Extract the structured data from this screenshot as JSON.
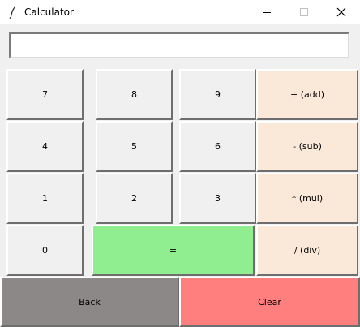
{
  "window": {
    "title": "Calculator",
    "icon": "feather-icon"
  },
  "display": {
    "value": ""
  },
  "keys": {
    "seven": "7",
    "eight": "8",
    "nine": "9",
    "four": "4",
    "five": "5",
    "six": "6",
    "one": "1",
    "two": "2",
    "three": "3",
    "zero": "0",
    "add": "+ (add)",
    "sub": "- (sub)",
    "mul": "* (mul)",
    "div": "/ (div)",
    "equals": "=",
    "back": "Back",
    "clear": "Clear"
  },
  "colors": {
    "operator": "#fae9d8",
    "equals": "#90ee90",
    "back": "#8c8888",
    "clear": "#ff7f7f",
    "number": "#f0f0f0"
  }
}
